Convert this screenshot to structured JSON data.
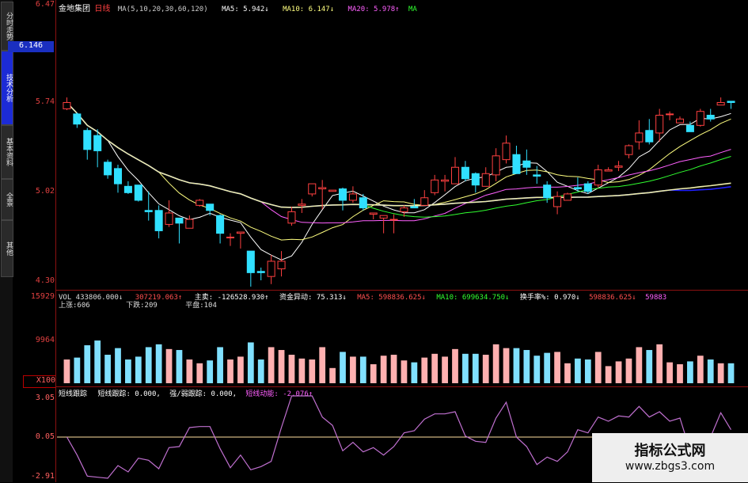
{
  "tabs": [
    {
      "label": "分时走势",
      "active": false
    },
    {
      "label": "技术分析",
      "active": true
    },
    {
      "label": "基本资料",
      "active": false
    },
    {
      "label": "全景",
      "active": false
    },
    {
      "label": "其他",
      "active": false
    }
  ],
  "price_header": {
    "stock": "金地集团",
    "period": "日线",
    "ma_params": "MA(5,10,20,30,60,120)",
    "ma5": "MA5: 5.942↓",
    "ma10": "MA10: 6.147↓",
    "ma20": "MA20: 5.978↑",
    "ma30": "MA"
  },
  "price_axis": {
    "ticks": [
      "6.47",
      "6.146",
      "5.74",
      "5.02",
      "4.30"
    ],
    "highlighted": "6.146",
    "low_mark": "4.30"
  },
  "vol_header": {
    "vol": "VOL 433806.000↓",
    "a": "307219.063↑",
    "zhumai": "主卖: -126528.930↑",
    "zijin": "资金异动: 75.313↓",
    "ma5": "MA5: 598836.625↓",
    "ma10": "MA10: 699634.750↓",
    "huanshou": "换手率%: 0.970↓",
    "b": "598836.625↓",
    "c": "59883"
  },
  "vol_sub": {
    "up": "上涨:606",
    "down": "下跌:209",
    "flat": "平盘:104"
  },
  "vol_axis": [
    "15929",
    "9964",
    "X100"
  ],
  "osc_header": {
    "name": "短线跟踪",
    "a": "短线跟踪: 0.000,",
    "b": "强/弱跟踪: 0.000,",
    "c": "短线动能: -2.076↑"
  },
  "osc_axis": [
    "3.05",
    "0.05",
    "-2.91"
  ],
  "watermark": {
    "title": "指标公式网",
    "url": "www.zbgs3.com"
  },
  "colors": {
    "up": "#ff4040",
    "down": "#30e0ff",
    "ma5": "#ffffff",
    "ma10": "#ffff80",
    "ma20": "#ff60ff",
    "ma30": "#30ff30",
    "ma60": "#2020ff",
    "ma120": "#eeeeaa"
  },
  "chart_data": {
    "type": "line",
    "title": "",
    "price_range": [
      4.3,
      6.47
    ],
    "candles": [
      {
        "o": 5.7,
        "c": 5.75,
        "h": 5.79,
        "l": 5.69
      },
      {
        "o": 5.66,
        "c": 5.58,
        "h": 5.67,
        "l": 5.55
      },
      {
        "o": 5.53,
        "c": 5.38,
        "h": 5.55,
        "l": 5.3
      },
      {
        "o": 5.49,
        "c": 5.37,
        "h": 5.54,
        "l": 5.24
      },
      {
        "o": 5.28,
        "c": 5.18,
        "h": 5.3,
        "l": 5.15
      },
      {
        "o": 5.23,
        "c": 5.11,
        "h": 5.26,
        "l": 5.04
      },
      {
        "o": 5.09,
        "c": 5.04,
        "h": 5.13,
        "l": 5.03
      },
      {
        "o": 5.1,
        "c": 4.98,
        "h": 5.1,
        "l": 4.97
      },
      {
        "o": 4.9,
        "c": 4.89,
        "h": 5.05,
        "l": 4.82
      },
      {
        "o": 4.9,
        "c": 4.74,
        "h": 4.94,
        "l": 4.68
      },
      {
        "o": 4.79,
        "c": 4.88,
        "h": 4.98,
        "l": 4.77
      },
      {
        "o": 4.84,
        "c": 4.8,
        "h": 4.84,
        "l": 4.64
      },
      {
        "o": 4.76,
        "c": 4.83,
        "h": 4.86,
        "l": 4.76
      },
      {
        "o": 4.94,
        "c": 4.98,
        "h": 4.99,
        "l": 4.93
      },
      {
        "o": 4.95,
        "c": 4.9,
        "h": 4.95,
        "l": 4.86
      },
      {
        "o": 4.86,
        "c": 4.72,
        "h": 4.87,
        "l": 4.64
      },
      {
        "o": 4.69,
        "c": 4.69,
        "h": 4.72,
        "l": 4.62
      },
      {
        "o": 4.72,
        "c": 4.73,
        "h": 4.73,
        "l": 4.6
      },
      {
        "o": 4.58,
        "c": 4.41,
        "h": 4.58,
        "l": 4.3
      },
      {
        "o": 4.42,
        "c": 4.41,
        "h": 4.45,
        "l": 4.35
      },
      {
        "o": 4.38,
        "c": 4.5,
        "h": 4.55,
        "l": 4.32
      },
      {
        "o": 4.44,
        "c": 4.5,
        "h": 4.58,
        "l": 4.38
      },
      {
        "o": 4.8,
        "c": 4.89,
        "h": 4.93,
        "l": 4.78
      },
      {
        "o": 4.94,
        "c": 4.95,
        "h": 4.99,
        "l": 4.88
      },
      {
        "o": 5.03,
        "c": 5.11,
        "h": 5.11,
        "l": 5.01
      },
      {
        "o": 5.07,
        "c": 5.08,
        "h": 5.14,
        "l": 4.91
      },
      {
        "o": 5.05,
        "c": 5.06,
        "h": 5.06,
        "l": 5.05
      },
      {
        "o": 5.07,
        "c": 4.98,
        "h": 5.08,
        "l": 4.9
      },
      {
        "o": 4.98,
        "c": 5.03,
        "h": 5.09,
        "l": 4.96
      },
      {
        "o": 5.0,
        "c": 4.92,
        "h": 5.03,
        "l": 4.9
      },
      {
        "o": 4.87,
        "c": 4.88,
        "h": 4.88,
        "l": 4.83
      },
      {
        "o": 4.84,
        "c": 4.86,
        "h": 4.86,
        "l": 4.72
      },
      {
        "o": 4.83,
        "c": 4.83,
        "h": 4.87,
        "l": 4.72
      },
      {
        "o": 4.89,
        "c": 4.92,
        "h": 4.94,
        "l": 4.85
      },
      {
        "o": 4.93,
        "c": 4.92,
        "h": 4.99,
        "l": 4.92
      },
      {
        "o": 4.94,
        "c": 5.0,
        "h": 5.06,
        "l": 4.94
      },
      {
        "o": 5.04,
        "c": 5.14,
        "h": 5.18,
        "l": 5.02
      },
      {
        "o": 5.13,
        "c": 5.14,
        "h": 5.18,
        "l": 5.05
      },
      {
        "o": 5.11,
        "c": 5.24,
        "h": 5.32,
        "l": 5.11
      },
      {
        "o": 5.24,
        "c": 5.15,
        "h": 5.29,
        "l": 5.13
      },
      {
        "o": 5.19,
        "c": 5.1,
        "h": 5.2,
        "l": 5.04
      },
      {
        "o": 5.09,
        "c": 5.19,
        "h": 5.24,
        "l": 5.09
      },
      {
        "o": 5.18,
        "c": 5.33,
        "h": 5.39,
        "l": 5.13
      },
      {
        "o": 5.3,
        "c": 5.43,
        "h": 5.49,
        "l": 5.27
      },
      {
        "o": 5.34,
        "c": 5.19,
        "h": 5.41,
        "l": 5.19
      },
      {
        "o": 5.29,
        "c": 5.24,
        "h": 5.38,
        "l": 5.18
      },
      {
        "o": 5.18,
        "c": 5.17,
        "h": 5.25,
        "l": 5.11
      },
      {
        "o": 5.1,
        "c": 5.0,
        "h": 5.13,
        "l": 4.96
      },
      {
        "o": 4.93,
        "c": 5.01,
        "h": 5.05,
        "l": 4.87
      },
      {
        "o": 4.98,
        "c": 5.03,
        "h": 5.04,
        "l": 4.98
      },
      {
        "o": 5.08,
        "c": 5.07,
        "h": 5.16,
        "l": 5.05
      },
      {
        "o": 5.11,
        "c": 5.05,
        "h": 5.13,
        "l": 5.03
      },
      {
        "o": 5.1,
        "c": 5.22,
        "h": 5.26,
        "l": 5.08
      },
      {
        "o": 5.21,
        "c": 5.22,
        "h": 5.24,
        "l": 5.21
      },
      {
        "o": 5.24,
        "c": 5.25,
        "h": 5.29,
        "l": 5.21
      },
      {
        "o": 5.34,
        "c": 5.41,
        "h": 5.42,
        "l": 5.31
      },
      {
        "o": 5.44,
        "c": 5.51,
        "h": 5.61,
        "l": 5.38
      },
      {
        "o": 5.53,
        "c": 5.44,
        "h": 5.62,
        "l": 5.42
      },
      {
        "o": 5.51,
        "c": 5.65,
        "h": 5.7,
        "l": 5.44
      },
      {
        "o": 5.66,
        "c": 5.66,
        "h": 5.68,
        "l": 5.61
      },
      {
        "o": 5.59,
        "c": 5.62,
        "h": 5.64,
        "l": 5.59
      },
      {
        "o": 5.57,
        "c": 5.52,
        "h": 5.6,
        "l": 5.52
      },
      {
        "o": 5.57,
        "c": 5.68,
        "h": 5.7,
        "l": 5.56
      },
      {
        "o": 5.65,
        "c": 5.62,
        "h": 5.7,
        "l": 5.6
      },
      {
        "o": 5.73,
        "c": 5.75,
        "h": 5.79,
        "l": 5.73
      },
      {
        "o": 5.76,
        "c": 5.75,
        "h": 5.76,
        "l": 5.7
      }
    ]
  }
}
